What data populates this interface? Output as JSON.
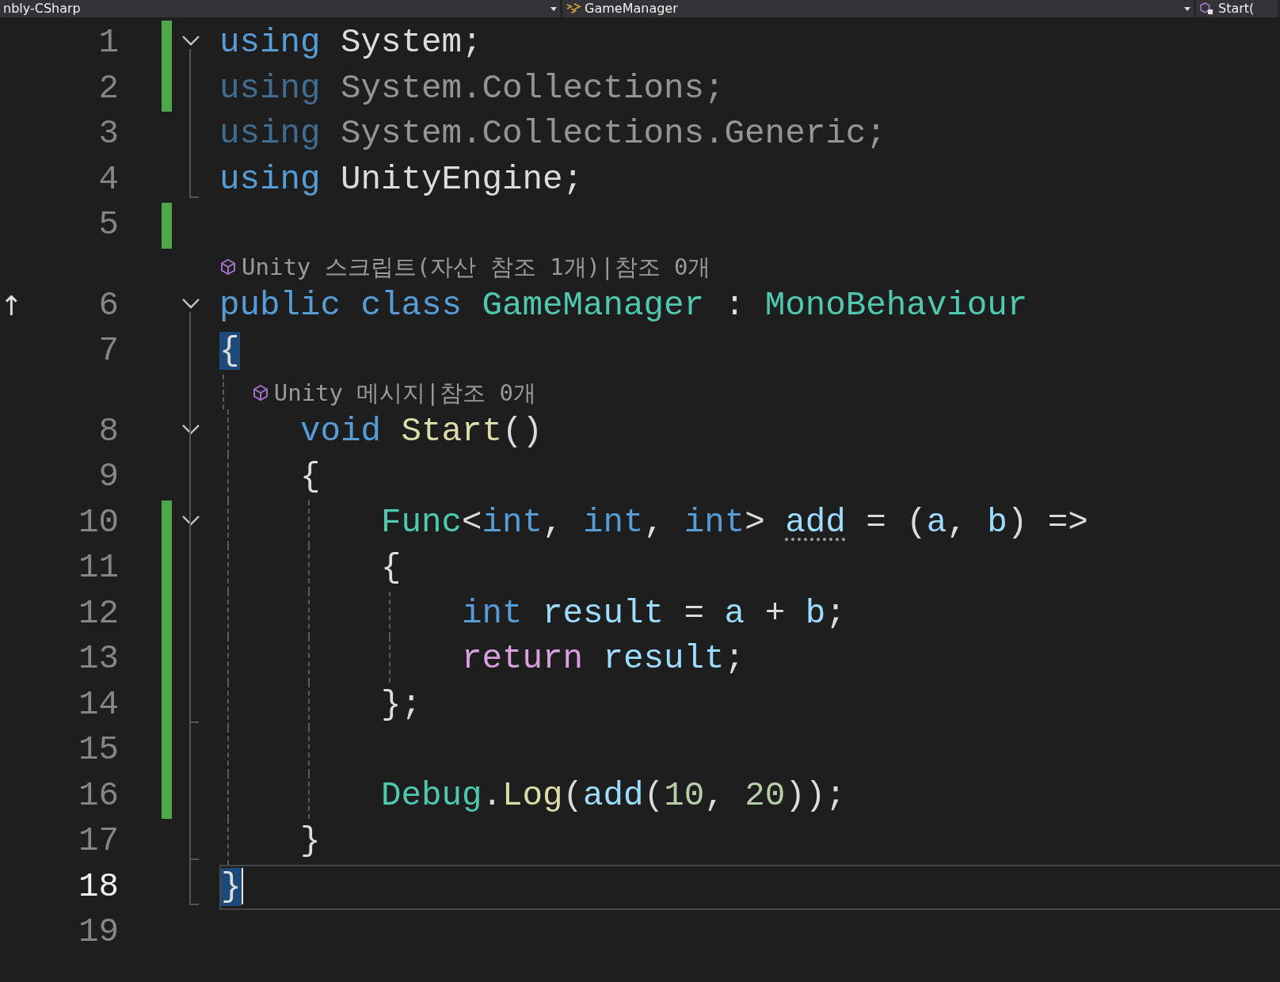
{
  "navigation_bar": {
    "project": "nbly-CSharp",
    "type": "GameManager",
    "member": "Start("
  },
  "lines": [
    {
      "kind": "code",
      "number": "1",
      "changed": true,
      "collapsible": true,
      "fold_end": false,
      "tokens": [
        {
          "text": "using",
          "kind": "keyword"
        },
        {
          "text": " System;",
          "kind": "plain"
        }
      ]
    },
    {
      "kind": "code",
      "number": "2",
      "changed": true,
      "collapsible": false,
      "fold_end": false,
      "faded": true,
      "tokens": [
        {
          "text": "using",
          "kind": "keyword"
        },
        {
          "text": " System.Collections;",
          "kind": "plain"
        }
      ]
    },
    {
      "kind": "code",
      "number": "3",
      "changed": false,
      "collapsible": false,
      "fold_end": false,
      "faded": true,
      "tokens": [
        {
          "text": "using",
          "kind": "keyword"
        },
        {
          "text": " System.Collections.Generic;",
          "kind": "plain"
        }
      ]
    },
    {
      "kind": "code",
      "number": "4",
      "changed": false,
      "collapsible": false,
      "fold_end": true,
      "faded": false,
      "tokens": [
        {
          "text": "using",
          "kind": "keyword"
        },
        {
          "text": " UnityEngine;",
          "kind": "plain"
        }
      ]
    },
    {
      "kind": "code",
      "number": "5",
      "changed": true,
      "collapsible": false,
      "fold_end": false
    },
    {
      "kind": "lens",
      "text": "Unity 스크립트(자산 참조 1개)|참조 0개"
    },
    {
      "kind": "code",
      "number": "6",
      "changed": false,
      "collapsible": true,
      "fold_end": false,
      "margin_mark": "↑",
      "tokens": [
        {
          "text": "public class",
          "kind": "keyword"
        },
        {
          "text": " GameManager",
          "kind": "type"
        },
        {
          "text": " : ",
          "kind": "plain"
        },
        {
          "text": "MonoBehaviour",
          "kind": "type"
        }
      ]
    },
    {
      "kind": "code",
      "number": "7",
      "changed": false,
      "collapsible": false,
      "fold_end": false,
      "tokens": [
        {
          "text": "{",
          "kind": "plain",
          "matched": true
        }
      ]
    },
    {
      "kind": "lens",
      "indent_guides": [
        true
      ],
      "text": "Unity 메시지|참조 0개"
    },
    {
      "kind": "code",
      "number": "8",
      "changed": false,
      "collapsible": true,
      "fold_end": false,
      "indent_guides": [
        true
      ],
      "tokens": [
        {
          "text": "void",
          "kind": "keyword"
        },
        {
          "text": " Start",
          "kind": "method"
        },
        {
          "text": "()",
          "kind": "plain"
        }
      ]
    },
    {
      "kind": "code",
      "number": "9",
      "changed": false,
      "collapsible": false,
      "fold_end": false,
      "indent_guides": [
        true
      ],
      "tokens": [
        {
          "text": "{",
          "kind": "plain"
        }
      ]
    },
    {
      "kind": "code",
      "number": "10",
      "changed": true,
      "collapsible": true,
      "fold_end": false,
      "indent_guides": [
        true,
        true
      ],
      "tokens": [
        {
          "text": "Func",
          "kind": "type"
        },
        {
          "text": "<",
          "kind": "plain"
        },
        {
          "text": "int",
          "kind": "keyword"
        },
        {
          "text": ", ",
          "kind": "plain"
        },
        {
          "text": "int",
          "kind": "keyword"
        },
        {
          "text": ", ",
          "kind": "plain"
        },
        {
          "text": "int",
          "kind": "keyword"
        },
        {
          "text": "> ",
          "kind": "plain"
        },
        {
          "text": "add",
          "kind": "variable",
          "hint": true
        },
        {
          "text": " = (",
          "kind": "plain"
        },
        {
          "text": "a",
          "kind": "variable"
        },
        {
          "text": ", ",
          "kind": "plain"
        },
        {
          "text": "b",
          "kind": "variable"
        },
        {
          "text": ") =>",
          "kind": "plain"
        }
      ]
    },
    {
      "kind": "code",
      "number": "11",
      "changed": true,
      "collapsible": false,
      "fold_end": false,
      "indent_guides": [
        true,
        true
      ],
      "tokens": [
        {
          "text": "{",
          "kind": "plain"
        }
      ]
    },
    {
      "kind": "code",
      "number": "12",
      "changed": true,
      "collapsible": false,
      "fold_end": false,
      "indent_guides": [
        true,
        true,
        true
      ],
      "tokens": [
        {
          "text": "int",
          "kind": "keyword"
        },
        {
          "text": " result",
          "kind": "variable"
        },
        {
          "text": " = ",
          "kind": "plain"
        },
        {
          "text": "a",
          "kind": "variable"
        },
        {
          "text": " + ",
          "kind": "plain"
        },
        {
          "text": "b",
          "kind": "variable"
        },
        {
          "text": ";",
          "kind": "plain"
        }
      ]
    },
    {
      "kind": "code",
      "number": "13",
      "changed": true,
      "collapsible": false,
      "fold_end": false,
      "indent_guides": [
        true,
        true,
        true
      ],
      "tokens": [
        {
          "text": "return",
          "kind": "control"
        },
        {
          "text": " result",
          "kind": "variable"
        },
        {
          "text": ";",
          "kind": "plain"
        }
      ]
    },
    {
      "kind": "code",
      "number": "14",
      "changed": true,
      "collapsible": false,
      "fold_end": true,
      "indent_guides": [
        true,
        true
      ],
      "tokens": [
        {
          "text": "};",
          "kind": "plain"
        }
      ]
    },
    {
      "kind": "code",
      "number": "15",
      "changed": true,
      "collapsible": false,
      "fold_end": false,
      "indent_guides": [
        true,
        true
      ]
    },
    {
      "kind": "code",
      "number": "16",
      "changed": true,
      "collapsible": false,
      "fold_end": false,
      "indent_guides": [
        true,
        true
      ],
      "tokens": [
        {
          "text": "Debug",
          "kind": "type"
        },
        {
          "text": ".",
          "kind": "plain"
        },
        {
          "text": "Log",
          "kind": "method"
        },
        {
          "text": "(",
          "kind": "plain"
        },
        {
          "text": "add",
          "kind": "variable"
        },
        {
          "text": "(",
          "kind": "plain"
        },
        {
          "text": "10",
          "kind": "number"
        },
        {
          "text": ", ",
          "kind": "plain"
        },
        {
          "text": "20",
          "kind": "number"
        },
        {
          "text": "));",
          "kind": "plain"
        }
      ]
    },
    {
      "kind": "code",
      "number": "17",
      "changed": false,
      "collapsible": false,
      "fold_end": true,
      "indent_guides": [
        true
      ],
      "tokens": [
        {
          "text": "}",
          "kind": "plain"
        }
      ]
    },
    {
      "kind": "code",
      "number": "18",
      "changed": false,
      "collapsible": false,
      "fold_end": true,
      "current": true,
      "tokens": [
        {
          "text": "}",
          "kind": "plain",
          "matched": true
        }
      ]
    },
    {
      "kind": "code",
      "number": "19",
      "changed": false,
      "collapsible": false,
      "fold_end": false
    }
  ]
}
